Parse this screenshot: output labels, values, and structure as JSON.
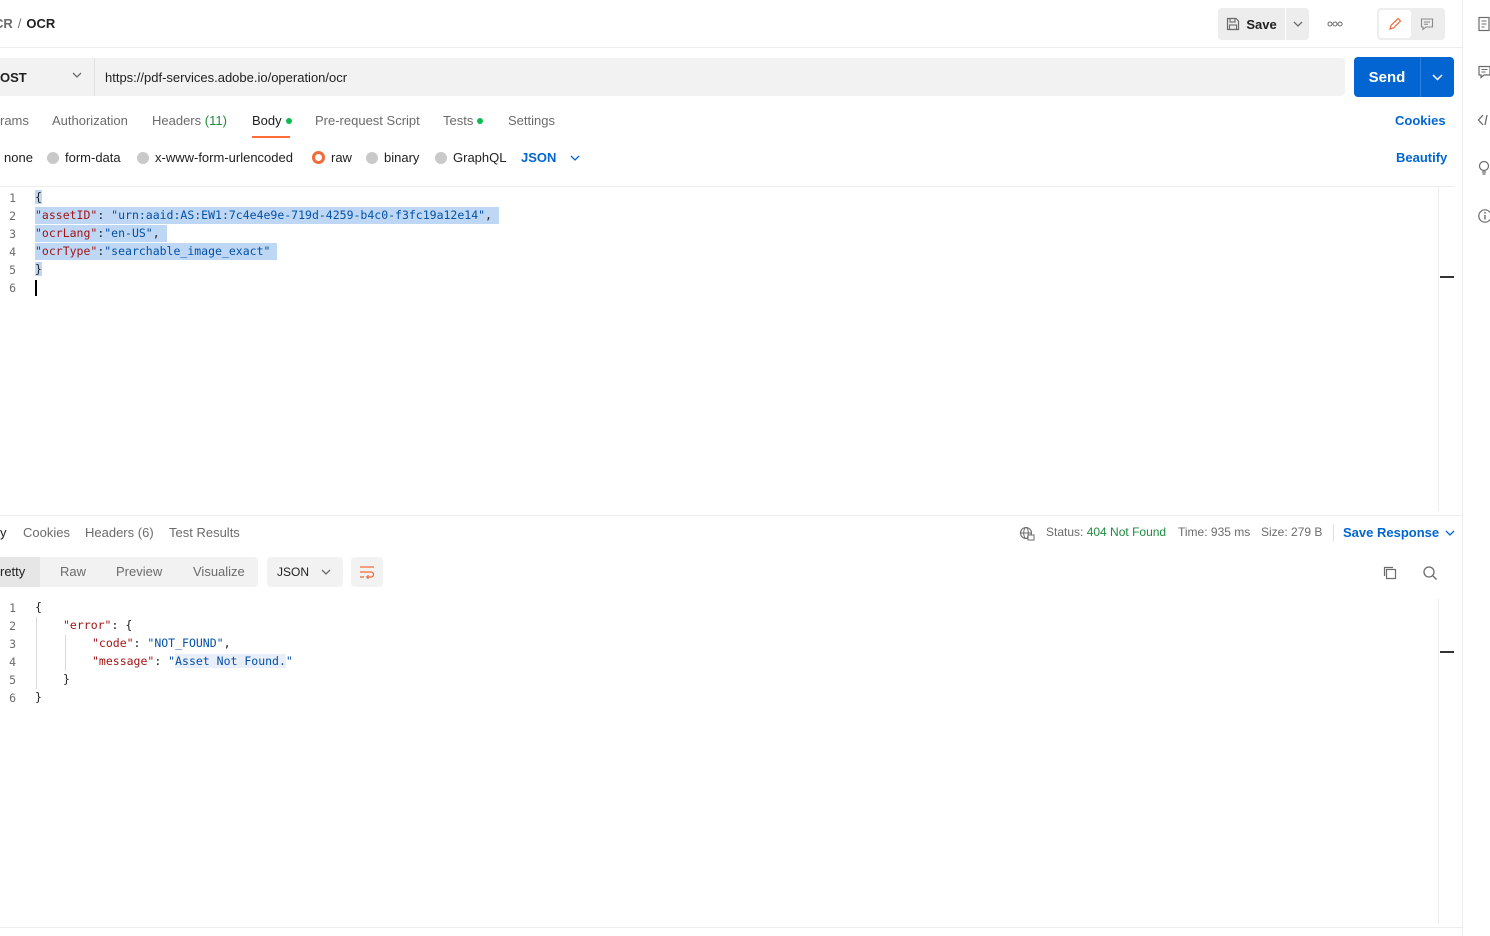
{
  "breadcrumb": {
    "parent": "CR",
    "separator": "/",
    "current": "OCR"
  },
  "toolbar": {
    "save_label": "Save",
    "more_label": "ooo"
  },
  "request": {
    "method": "OST",
    "url": "https://pdf-services.adobe.io/operation/ocr",
    "send_label": "Send"
  },
  "request_tabs": {
    "params": "rams",
    "authorization": "Authorization",
    "headers": "Headers",
    "headers_count": "(11)",
    "body": "Body",
    "prerequest": "Pre-request Script",
    "tests": "Tests",
    "settings": "Settings",
    "cookies": "Cookies"
  },
  "body_types": {
    "none": "none",
    "form_data": "form-data",
    "urlencoded": "x-www-form-urlencoded",
    "raw": "raw",
    "binary": "binary",
    "graphql": "GraphQL",
    "language": "JSON",
    "beautify": "Beautify"
  },
  "request_body": {
    "line_numbers": [
      "1",
      "2",
      "3",
      "4",
      "5",
      "6"
    ],
    "l1": "{",
    "l2_key": "\"assetID\"",
    "l2_sep": ": ",
    "l2_val": "\"urn:aaid:AS:EW1:7c4e4e9e-719d-4259-b4c0-f3fc19a12e14\"",
    "l2_end": ",",
    "l3_key": "\"ocrLang\"",
    "l3_sep": ":",
    "l3_val": "\"en-US\"",
    "l3_end": ",",
    "l4_key": "\"ocrType\"",
    "l4_sep": ":",
    "l4_val": "\"searchable_image_exact\"",
    "l5": "}"
  },
  "response_tabs": {
    "body": "y",
    "cookies": "Cookies",
    "headers": "Headers",
    "headers_count": "(6)",
    "test_results": "Test Results",
    "status_label": "Status:",
    "status_value": "404 Not Found",
    "time_label": "Time:",
    "time_value": "935 ms",
    "size_label": "Size:",
    "size_value": "279 B",
    "save_response": "Save Response"
  },
  "response_view": {
    "pretty": "retty",
    "raw": "Raw",
    "preview": "Preview",
    "visualize": "Visualize",
    "format": "JSON"
  },
  "response_body": {
    "line_numbers": [
      "1",
      "2",
      "3",
      "4",
      "5",
      "6"
    ],
    "l1": "{",
    "l2_key": "\"error\"",
    "l2_rest": ": {",
    "l3_key": "\"code\"",
    "l3_sep": ": ",
    "l3_val": "\"NOT_FOUND\"",
    "l3_end": ",",
    "l4_key": "\"message\"",
    "l4_sep": ": ",
    "l4_q1": "\"",
    "l4_val": "Asset Not Found.",
    "l4_q2": "\"",
    "l5": "}",
    "l6": "}"
  },
  "colors": {
    "accent_blue": "#0265d2",
    "tab_underline": "#ff6c37",
    "status_green": "#1e8a3e",
    "dot_green": "#0cbb52",
    "selection": "#bdd7f5"
  },
  "icons": {
    "save": "floppy-disk-icon",
    "edit": "pencil-icon",
    "comment": "comment-icon",
    "wrap": "wrap-lines-icon",
    "copy": "copy-icon",
    "search": "search-icon",
    "globe": "network-globe-icon"
  }
}
